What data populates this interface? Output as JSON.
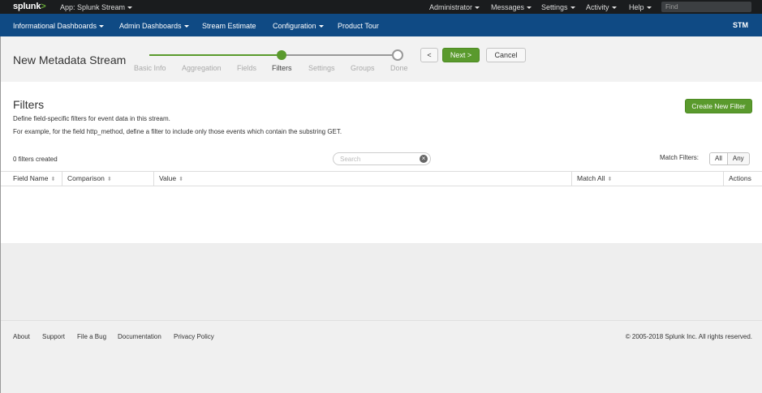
{
  "topbar": {
    "logo": "splunk",
    "logo_mark": ">",
    "app_label": "App: Splunk Stream",
    "menus": [
      "Administrator",
      "Messages",
      "Settings",
      "Activity",
      "Help"
    ],
    "find_placeholder": "Find"
  },
  "appnav": {
    "items": [
      "Informational Dashboards",
      "Admin Dashboards",
      "Stream Estimate",
      "Configuration",
      "Product Tour"
    ],
    "app_badge": "STM"
  },
  "wizard": {
    "title": "New Metadata Stream",
    "steps": [
      "Basic Info",
      "Aggregation",
      "Fields",
      "Filters",
      "Settings",
      "Groups",
      "Done"
    ],
    "active_step": "Filters",
    "back_label": "<",
    "next_label": "Next >",
    "cancel_label": "Cancel"
  },
  "filters": {
    "heading": "Filters",
    "description_1": "Define field-specific filters for event data in this stream.",
    "description_2": "For example, for the field http_method, define a filter to include only those events which contain the substring GET.",
    "create_label": "Create New Filter",
    "count_text": "0 filters created",
    "search_placeholder": "Search",
    "match_label": "Match Filters:",
    "match_options": [
      "All",
      "Any"
    ],
    "columns": [
      "Field Name",
      "Comparison",
      "Value",
      "Match All",
      "Actions"
    ]
  },
  "footer": {
    "links": [
      "About",
      "Support",
      "File a Bug",
      "Documentation",
      "Privacy Policy"
    ],
    "copyright": "© 2005-2018 Splunk Inc. All rights reserved."
  },
  "colors": {
    "topbar": "#1a1c1e",
    "appbar": "#0f4a84",
    "accent_green": "#5a9a2d"
  }
}
